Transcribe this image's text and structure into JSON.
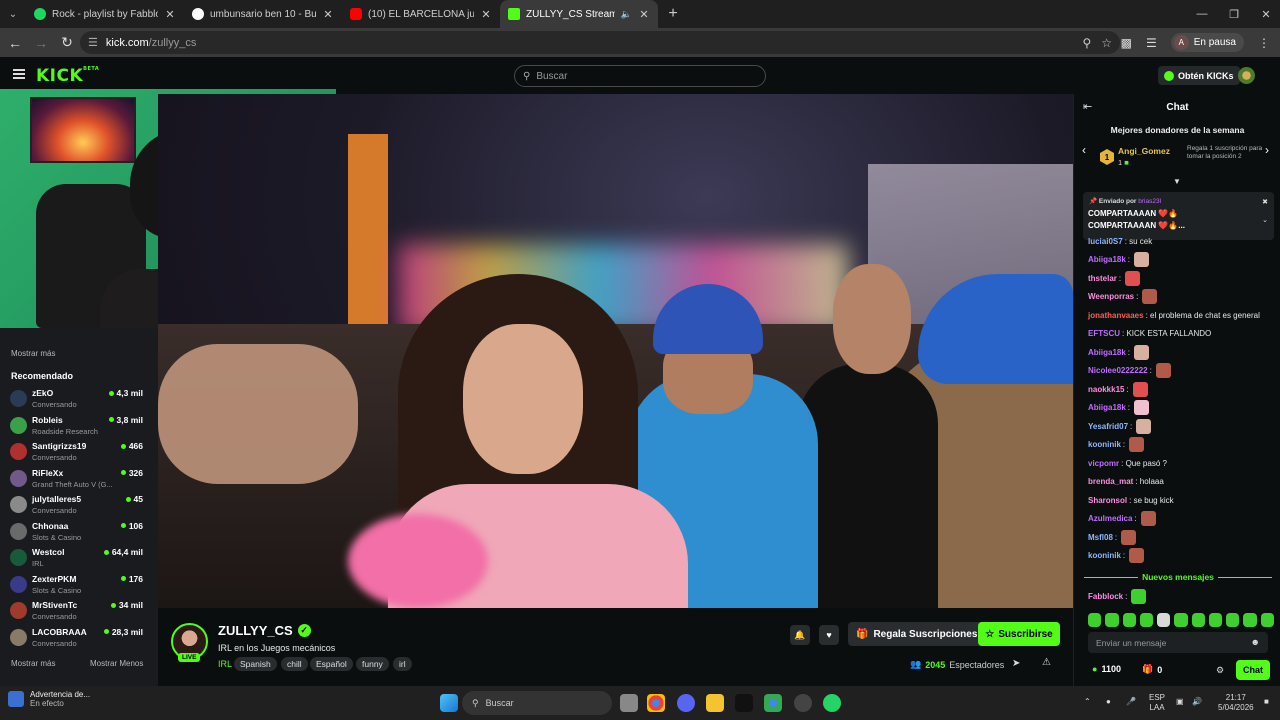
{
  "browser": {
    "tabs": [
      {
        "title": "Rock - playlist by Fabblock.Jn |",
        "color": "#1ed760",
        "active": false
      },
      {
        "title": "umbunsario ben 10 - Buscar co",
        "color": "#ffffff",
        "active": false
      },
      {
        "title": "(10) EL BARCELONA jugó un pa",
        "color": "#ff0000",
        "active": false
      },
      {
        "title": "ZULLYY_CS Stream - Watch",
        "color": "#53fc18",
        "active": true
      }
    ],
    "url_host": "kick.com",
    "url_path": "/zullyy_cs",
    "profile_initial": "A",
    "profile_status": "En pausa"
  },
  "kick": {
    "logo": "KICK",
    "logo_sup": "BETA",
    "search_placeholder": "Buscar",
    "get_kicks": "Obtén KICKs",
    "accent": "#53fc18"
  },
  "sidebar": {
    "show_more_top": "Mostrar más",
    "recommended_title": "Recomendado",
    "recommended": [
      {
        "name": "zEkO",
        "category": "Conversando",
        "viewers": "4,3 mil",
        "color": "#2b3a55"
      },
      {
        "name": "Robleis",
        "category": "Roadside Research",
        "viewers": "3,8 mil",
        "color": "#3aa04a"
      },
      {
        "name": "Santigrizzs19",
        "category": "Conversando",
        "viewers": "466",
        "color": "#b03030"
      },
      {
        "name": "RiFleXx",
        "category": "Grand Theft Auto V (G...",
        "viewers": "326",
        "color": "#705a8a"
      },
      {
        "name": "julytalleres5",
        "category": "Conversando",
        "viewers": "45",
        "color": "#8a8a8a"
      },
      {
        "name": "Chhonaa",
        "category": "Slots & Casino",
        "viewers": "106",
        "color": "#6a6a6a"
      },
      {
        "name": "Westcol",
        "category": "IRL",
        "viewers": "64,4 mil",
        "color": "#1a5a3a"
      },
      {
        "name": "ZexterPKM",
        "category": "Slots & Casino",
        "viewers": "176",
        "color": "#3a3a8a"
      },
      {
        "name": "MrStivenTc",
        "category": "Conversando",
        "viewers": "34 mil",
        "color": "#a03a2a"
      },
      {
        "name": "LACOBRAAA",
        "category": "Conversando",
        "viewers": "28,3 mil",
        "color": "#8a7a6a"
      }
    ],
    "show_more": "Mostrar más",
    "show_less": "Mostrar Menos"
  },
  "stream": {
    "channel": "ZULLYY_CS",
    "live": "LIVE",
    "title": "IRL en los Juegos mecánicos",
    "category": "IRL",
    "tags": [
      "Spanish",
      "chill",
      "Español",
      "funny",
      "irl"
    ],
    "gift_label": "Regala Suscripciones",
    "subscribe_label": "Suscribirse",
    "viewers": "2045",
    "viewers_label": "Espectadores"
  },
  "chat": {
    "title": "Chat",
    "donors_title": "Mejores donadores de la semana",
    "donor_rank": "1",
    "donor_name": "Angi_Gomez",
    "donor_count": "1",
    "donor_hint": "Regala 1 suscripción para tomar la posición 2",
    "pinned_by_label": "Enviado por",
    "pinned_by_user": "brias23l",
    "pinned_line1": "COMPARTAAAAN ❤️🔥",
    "pinned_line2": "COMPARTAAAAN ❤️🔥...",
    "messages": [
      {
        "user": "luciai0S7",
        "text": ": su cek",
        "color": "#8fb7ff",
        "emote": ""
      },
      {
        "user": "Abiiga18k",
        "text": ":",
        "color": "#c06cff",
        "emote": "#d8b0a0"
      },
      {
        "user": "thstelar",
        "text": ":",
        "color": "#ff8ae0",
        "emote": "#e05050"
      },
      {
        "user": "Weenporras",
        "text": ":",
        "color": "#ff8ae0",
        "emote": "#b05a4a"
      },
      {
        "user": "jonathanvaaes",
        "text": ": el problema de chat es general",
        "color": "#ff5a5a",
        "emote": ""
      },
      {
        "user": "EFTSCU",
        "text": ": KICK ESTA FALLANDO",
        "color": "#c06cff",
        "emote": ""
      },
      {
        "user": "Abiiga18k",
        "text": ":",
        "color": "#c06cff",
        "emote": "#d8b0a0"
      },
      {
        "user": "Nicolee0222222",
        "text": ":",
        "color": "#c06cff",
        "emote": "#b05a4a"
      },
      {
        "user": "naokkk15",
        "text": ":",
        "color": "#ff8ae0",
        "emote": "#e05050"
      },
      {
        "user": "Abiiga18k",
        "text": ":",
        "color": "#c06cff",
        "emote": "#f0c0d0"
      },
      {
        "user": "Yesafrid07",
        "text": ":",
        "color": "#8fb7ff",
        "emote": "#d8b0a0"
      },
      {
        "user": "kooninik",
        "text": ":",
        "color": "#8fb7ff",
        "emote": "#b05a4a"
      },
      {
        "user": "vicpomr",
        "text": ": Que pasó ?",
        "color": "#c06cff",
        "emote": ""
      },
      {
        "user": "brenda_mat",
        "text": ": holaaa",
        "color": "#ff8ae0",
        "emote": ""
      },
      {
        "user": "Sharonsol",
        "text": ": se bug kick",
        "color": "#ff8ae0",
        "emote": ""
      },
      {
        "user": "Azulmedica",
        "text": ":",
        "color": "#c06cff",
        "emote": "#b05a4a"
      },
      {
        "user": "Msfl08",
        "text": ":",
        "color": "#8fb7ff",
        "emote": "#b05a4a"
      },
      {
        "user": "kooninik",
        "text": ":",
        "color": "#8fb7ff",
        "emote": "#b05a4a"
      }
    ],
    "new_messages": "Nuevos mensajes",
    "last_message_user": "Fabblock",
    "input_placeholder": "Enviar un mensaje",
    "kicks_balance": "1100",
    "subs_count": "0",
    "send_label": "Chat"
  },
  "taskbar": {
    "weather_title": "Advertencia de...",
    "weather_sub": "En efecto",
    "search_label": "Buscar",
    "lang_line1": "ESP",
    "lang_line2": "LAA",
    "time": "21:17",
    "date": "5/04/2026"
  }
}
